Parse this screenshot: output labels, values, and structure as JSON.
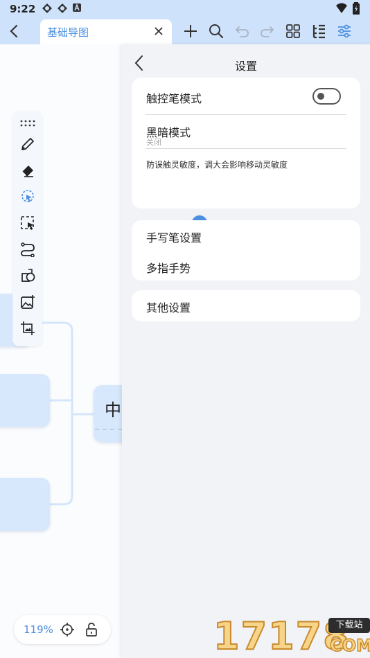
{
  "status_bar": {
    "time": "9:22"
  },
  "toolbar": {
    "tab_title": "基础导图"
  },
  "canvas": {
    "center_node_text": "中"
  },
  "zoom": {
    "level": "119%"
  },
  "settings": {
    "title": "设置",
    "stylus_mode_label": "触控笔模式",
    "stylus_mode_on": false,
    "dark_mode_label": "黑暗模式",
    "dark_mode_value": "关闭",
    "sensitivity_hint": "防误触灵敏度，调大会影响移动灵敏度",
    "sensitivity_value": 0.25,
    "pen_settings_label": "手写笔设置",
    "multi_finger_label": "多指手势",
    "other_settings_label": "其他设置"
  },
  "colors": {
    "accent": "#4a8fe0",
    "toolbar_bg": "#cfe2fb",
    "node_fill": "#d8e8fc",
    "panel_bg": "#f1f3f6"
  },
  "watermark": {
    "digits": "17178",
    "badge": "下载站",
    "suffix": "COM"
  }
}
